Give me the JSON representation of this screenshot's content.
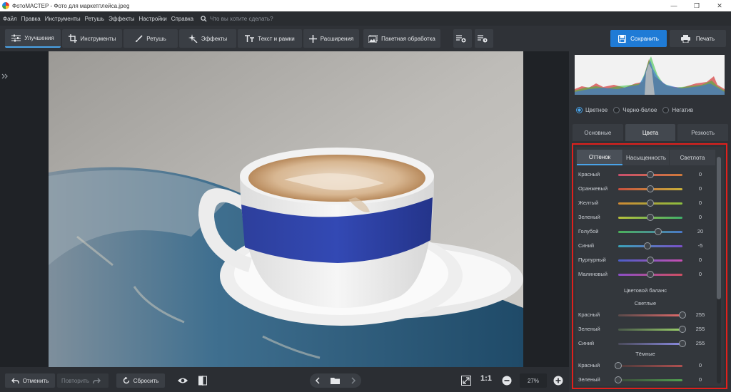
{
  "window": {
    "title": "ФотоМАСТЕР - Фото для маркетплейса.jpeg",
    "minimize": "—",
    "maximize": "❐",
    "close": "✕"
  },
  "menu": {
    "items": [
      "Файл",
      "Правка",
      "Инструменты",
      "Ретушь",
      "Эффекты",
      "Настройки",
      "Справка"
    ],
    "search_placeholder": "Что вы хотите сделать?"
  },
  "toolbar": {
    "tabs": [
      {
        "label": "Улучшения",
        "icon": "sliders-icon"
      },
      {
        "label": "Инструменты",
        "icon": "crop-icon"
      },
      {
        "label": "Ретушь",
        "icon": "brush-icon"
      },
      {
        "label": "Эффекты",
        "icon": "sparkle-icon"
      },
      {
        "label": "Текст и рамки",
        "icon": "text-icon"
      },
      {
        "label": "Расширения",
        "icon": "plus-icon"
      },
      {
        "label": "Пакетная обработка",
        "icon": "batch-icon"
      }
    ],
    "save_label": "Сохранить",
    "print_label": "Печать"
  },
  "bottom": {
    "undo_label": "Отменить",
    "redo_label": "Повторить",
    "reset_label": "Сбросить",
    "zoom_ratio": "1:1",
    "zoom_value": "27%"
  },
  "panel": {
    "modes": [
      {
        "label": "Цветное",
        "selected": true
      },
      {
        "label": "Черно-белое",
        "selected": false
      },
      {
        "label": "Негатив",
        "selected": false
      }
    ],
    "tabs": [
      "Основные",
      "Цвета",
      "Резкость"
    ],
    "active_tab": 1,
    "subtabs": [
      "Оттенок",
      "Насыщенность",
      "Светлота"
    ],
    "active_subtab": 0,
    "hue_sliders": [
      {
        "label": "Красный",
        "value": "0",
        "pos": 0.5,
        "c1": "#c94f6d",
        "c2": "#d07a3a"
      },
      {
        "label": "Оранжевый",
        "value": "0",
        "pos": 0.5,
        "c1": "#c9503f",
        "c2": "#c9b23a"
      },
      {
        "label": "Желтый",
        "value": "0",
        "pos": 0.5,
        "c1": "#d08a34",
        "c2": "#8cbf3f"
      },
      {
        "label": "Зеленый",
        "value": "0",
        "pos": 0.5,
        "c1": "#b9c13a",
        "c2": "#3fb06a"
      },
      {
        "label": "Голубой",
        "value": "20",
        "pos": 0.62,
        "c1": "#4bb159",
        "c2": "#4a78c9"
      },
      {
        "label": "Синий",
        "value": "-5",
        "pos": 0.46,
        "c1": "#3aa3b8",
        "c2": "#7a4fc9"
      },
      {
        "label": "Пурпурный",
        "value": "0",
        "pos": 0.5,
        "c1": "#4a5ec9",
        "c2": "#c94fb3"
      },
      {
        "label": "Малиновый",
        "value": "0",
        "pos": 0.5,
        "c1": "#8b4fc9",
        "c2": "#d04f62"
      }
    ],
    "balance_title": "Цветовой баланс",
    "highlights_title": "Светлые",
    "highlights": [
      {
        "label": "Красный",
        "value": "255",
        "pos": 1.0,
        "c1": "#5a4a4a",
        "c2": "#e06a6a"
      },
      {
        "label": "Зеленый",
        "value": "255",
        "pos": 1.0,
        "c1": "#4a5a4a",
        "c2": "#9ad06a"
      },
      {
        "label": "Синий",
        "value": "255",
        "pos": 1.0,
        "c1": "#4a4a5a",
        "c2": "#8a8ae0"
      }
    ],
    "shadows_title": "Тёмные",
    "shadows": [
      {
        "label": "Красный",
        "value": "0",
        "pos": 0.0,
        "c1": "#4a3a3a",
        "c2": "#b05050"
      },
      {
        "label": "Зеленый",
        "value": "0",
        "pos": 0.0,
        "c1": "#3a4a3a",
        "c2": "#50a050"
      }
    ]
  },
  "colors": {
    "accent": "#4aa3e8",
    "save_button": "#1f7bd6",
    "highlight_frame": "#e0201c"
  }
}
